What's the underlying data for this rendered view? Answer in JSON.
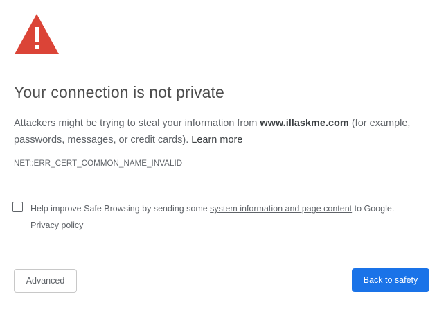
{
  "colors": {
    "warning_red": "#db4437",
    "primary_blue": "#1a73e8",
    "text_gray": "#5f6368",
    "title_gray": "#4d4d4d"
  },
  "icon": {
    "name": "warning-triangle-icon",
    "symbol": "!"
  },
  "title": "Your connection is not private",
  "description": {
    "before_domain": "Attackers might be trying to steal your information from ",
    "domain": "www.illaskme.com",
    "after_domain": " (for example, passwords, messages, or credit cards). ",
    "learn_more": "Learn more"
  },
  "error_code": "NET::ERR_CERT_COMMON_NAME_INVALID",
  "safe_browsing": {
    "checked": false,
    "text_before": "Help improve Safe Browsing by sending some ",
    "link_system_info": "system information and page content",
    "text_after": " to Google.",
    "privacy_policy": "Privacy policy"
  },
  "buttons": {
    "advanced": "Advanced",
    "back_to_safety": "Back to safety"
  }
}
